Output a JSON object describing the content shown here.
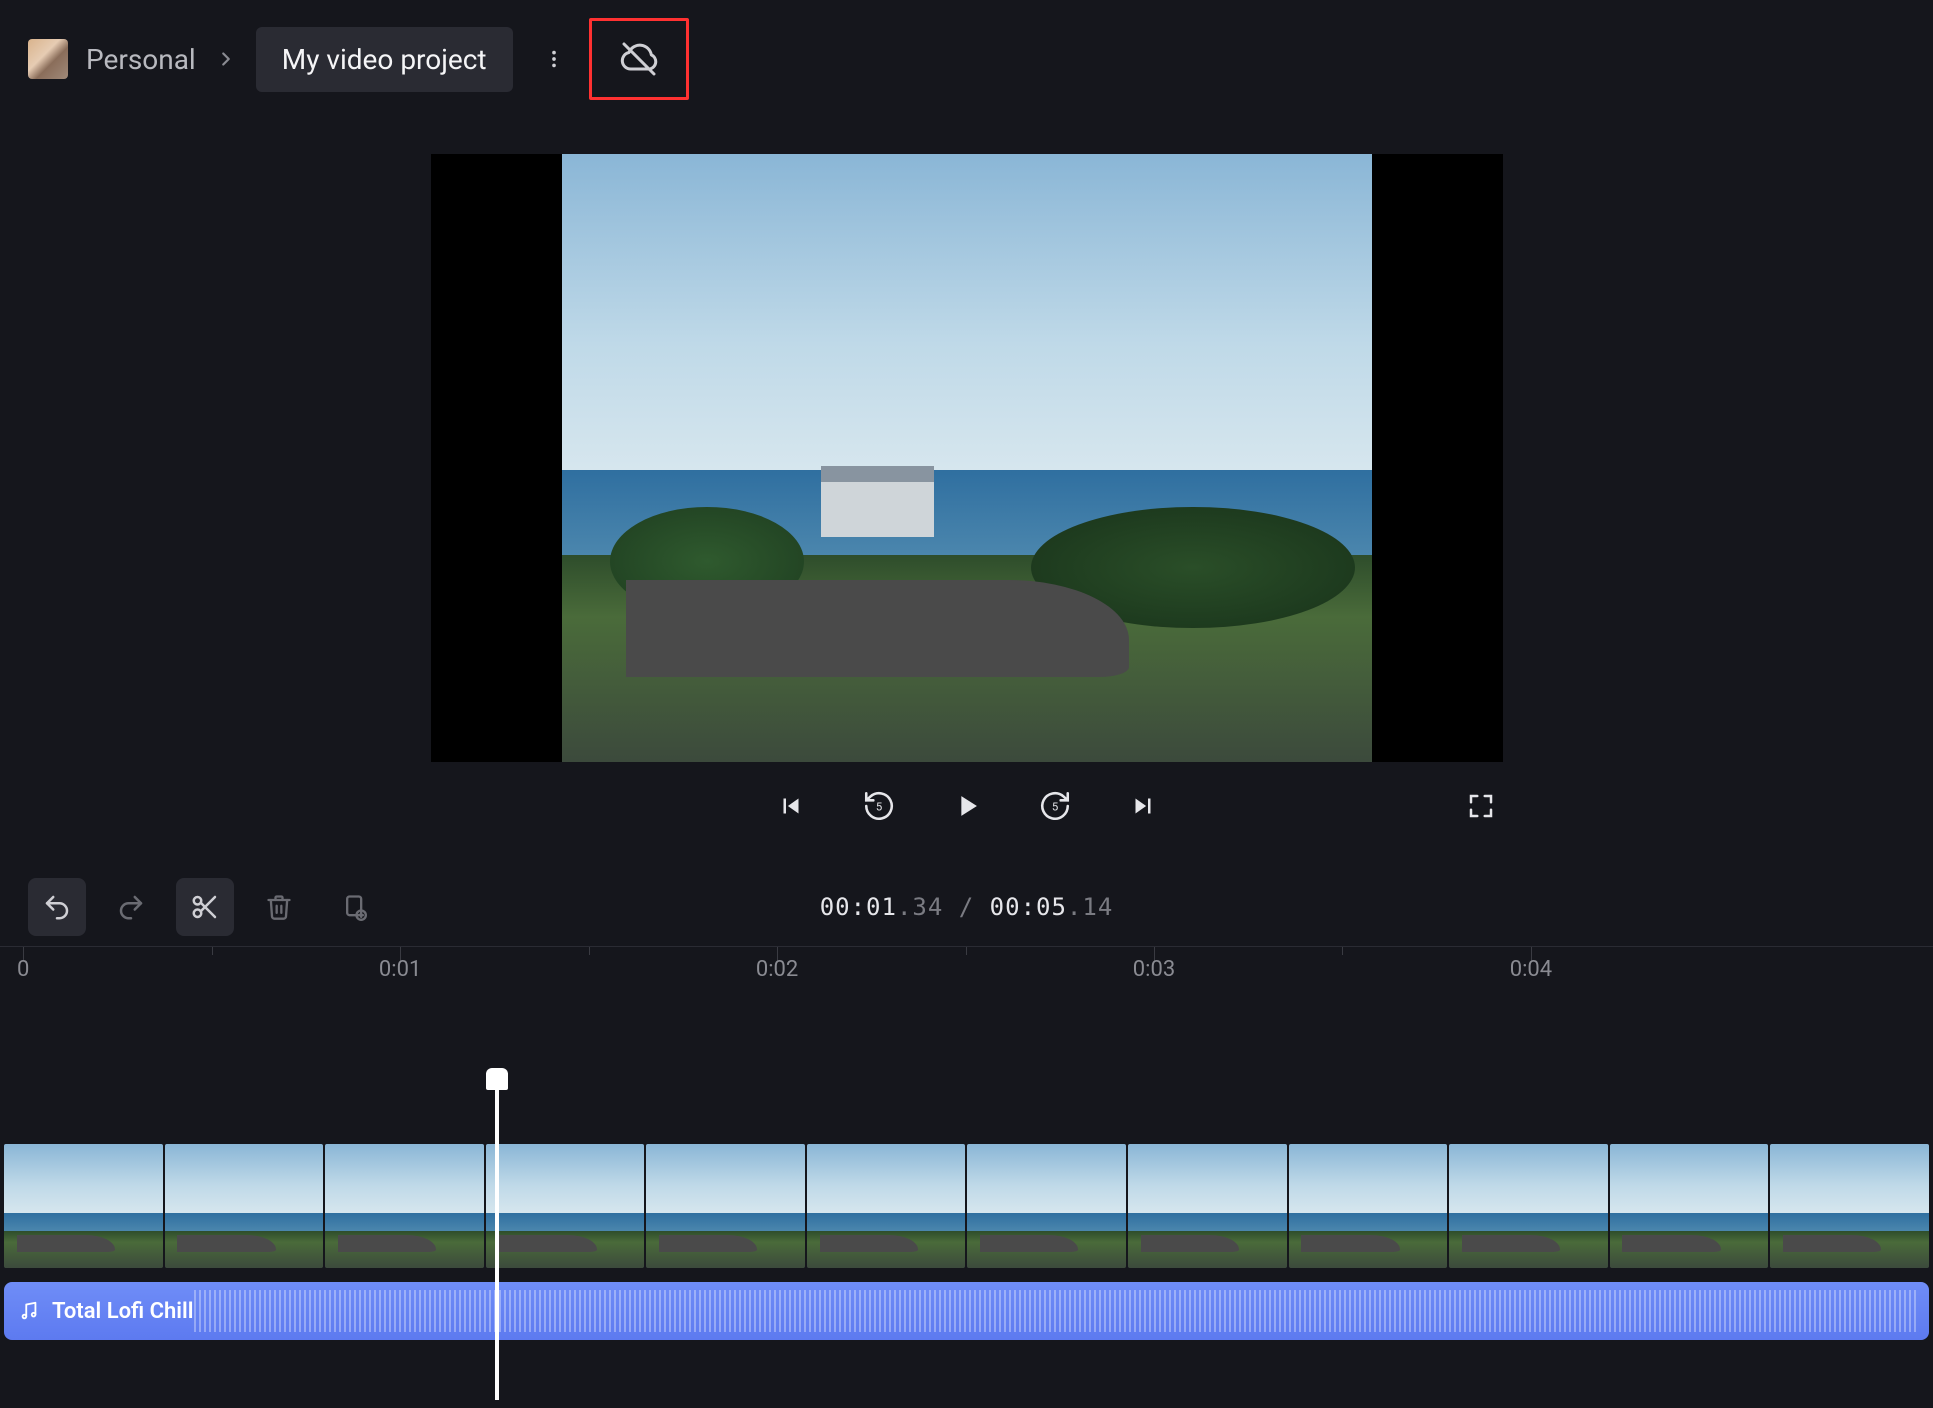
{
  "header": {
    "workspace": "Personal",
    "project_title": "My video project"
  },
  "icons": {
    "chevron_right": "chevron-right",
    "more_vert": "more-vertical",
    "cloud_off": "cloud-off",
    "skip_prev": "skip-previous",
    "replay5": "replay-5",
    "play": "play",
    "forward5": "forward-5",
    "skip_next": "skip-next",
    "fullscreen": "fullscreen",
    "undo": "undo",
    "redo": "redo",
    "scissors": "scissors",
    "trash": "trash",
    "paste_add": "paste-add",
    "music": "music-note"
  },
  "timecode": {
    "current_main": "00:01",
    "current_sub": ".34",
    "sep": " / ",
    "total_main": "00:05",
    "total_sub": ".14"
  },
  "ruler": {
    "labels": [
      "0",
      "0:01",
      "0:02",
      "0:03",
      "0:04"
    ],
    "label_positions_pct": [
      1.2,
      20.7,
      40.2,
      59.7,
      79.2
    ]
  },
  "playhead": {
    "position_pct": 25.6
  },
  "timeline": {
    "video_thumb_count": 12,
    "audio_clip_label": "Total Lofi Chill"
  }
}
